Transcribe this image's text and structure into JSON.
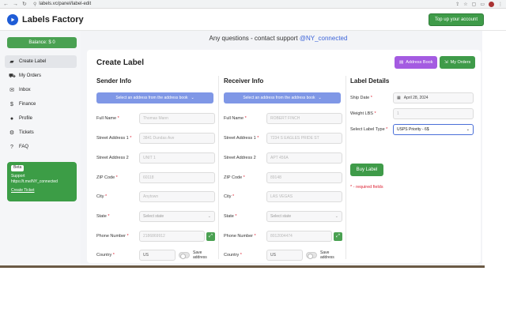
{
  "browser": {
    "url": "labels.vc/panel/label-edit"
  },
  "header": {
    "app_name": "Labels Factory",
    "topup_label": "Top up your account"
  },
  "sidebar": {
    "balance": "Balance: $ 0",
    "items": [
      {
        "label": "Create Label",
        "icon": "tag-icon",
        "active": true
      },
      {
        "label": "My Orders",
        "icon": "truck-icon",
        "active": false
      },
      {
        "label": "Inbox",
        "icon": "inbox-icon",
        "active": false
      },
      {
        "label": "Finance",
        "icon": "dollar-icon",
        "active": false
      },
      {
        "label": "Profile",
        "icon": "user-icon",
        "active": false
      },
      {
        "label": "Tickets",
        "icon": "ticket-icon",
        "active": false
      },
      {
        "label": "FAQ",
        "icon": "question-icon",
        "active": false
      }
    ],
    "beta": {
      "tag": "Beta",
      "line1": "Support",
      "line2": "https://t.me/NY_connected",
      "link": "Create Ticket"
    }
  },
  "main": {
    "support_text": "Any questions - contact support",
    "support_handle": "@NY_connected",
    "title": "Create Label",
    "address_book_label": "Address Book",
    "my_orders_label": "My Orders"
  },
  "sender": {
    "title": "Sender Info",
    "address_select": "Select an address from the address book",
    "full_name_label": "Full Name",
    "full_name_ph": "Thomas Mann",
    "street1_label": "Street Address 1",
    "street1_ph": "3841 Dundas Ave",
    "street2_label": "Street Address 2",
    "street2_ph": "UNIT 1",
    "zip_label": "ZIP Code",
    "zip_ph": "60118",
    "city_label": "City",
    "city_ph": "Anytown",
    "state_label": "State",
    "state_ph": "Select state",
    "phone_label": "Phone Number",
    "phone_ph": "2186869912",
    "country_label": "Country",
    "country_value": "US",
    "save_label": "Save address"
  },
  "receiver": {
    "title": "Receiver Info",
    "address_select": "Select an address from the address book",
    "full_name_label": "Full Name",
    "full_name_ph": "ROBERT FINCH",
    "street1_label": "Street Address 1",
    "street1_ph": "7234 S EAGLES PRIDE ST",
    "street2_label": "Street Address 2",
    "street2_ph": "APT 456A",
    "zip_label": "ZIP Code",
    "zip_ph": "89148",
    "city_label": "City",
    "city_ph": "LAS VEGAS",
    "state_label": "State",
    "state_ph": "Select state",
    "phone_label": "Phone Number",
    "phone_ph": "8012004474",
    "country_label": "Country",
    "country_value": "US",
    "save_label": "Save address"
  },
  "label_details": {
    "title": "Label Details",
    "ship_date_label": "Ship Date",
    "ship_date": "April 28, 2024",
    "weight_label": "Weight LBS",
    "weight_ph": "1",
    "type_label": "Select Label Type",
    "type_value": "USPS Priority - 6$",
    "buy_label": "Buy Label",
    "required_note": "* - required fields"
  },
  "colors": {
    "green": "#3f9b49",
    "purple": "#a45be1",
    "address_btn": "#7f97e6",
    "brand_blue": "#1e5cd6",
    "required_red": "#d23"
  }
}
